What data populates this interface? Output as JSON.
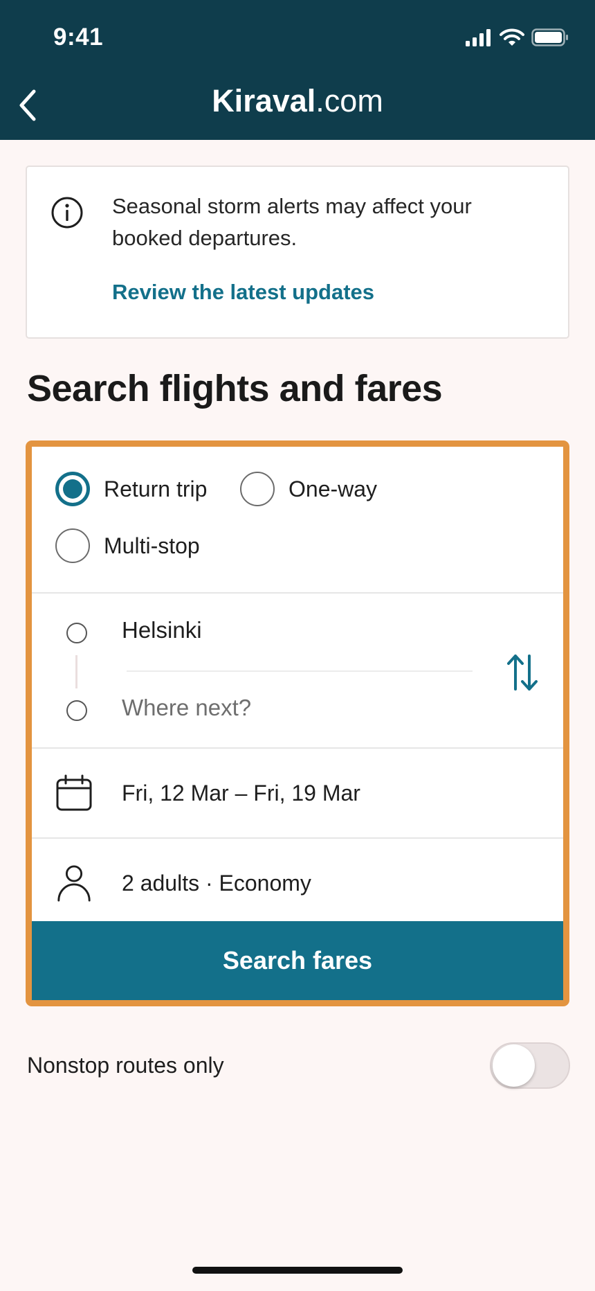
{
  "status_bar": {
    "time": "9:41"
  },
  "header": {
    "brand_bold": "Kiraval",
    "brand_rest": ".com"
  },
  "alert": {
    "message": "Seasonal storm alerts may affect your booked departures.",
    "link": "Review the latest updates"
  },
  "page_title": "Search flights and fares",
  "search_form": {
    "trip_types": [
      {
        "label": "Return trip",
        "selected": true
      },
      {
        "label": "One-way",
        "selected": false
      },
      {
        "label": "Multi-stop",
        "selected": false
      }
    ],
    "origin": "Helsinki",
    "destination_placeholder": "Where next?",
    "dates": "Fri, 12 Mar – Fri, 19 Mar",
    "passengers": "2 adults · Economy",
    "submit_label": "Search fares"
  },
  "nonstop": {
    "label": "Nonstop routes only",
    "enabled": false
  },
  "colors": {
    "header_bg": "#0f3d4c",
    "accent": "#13708a",
    "card_border": "#e39440",
    "page_bg": "#fdf6f5"
  },
  "icons": {
    "back": "chevron-left-icon",
    "info": "info-circle-icon",
    "swap": "swap-vertical-icon",
    "calendar": "calendar-icon",
    "person": "person-icon",
    "signal": "cellular-signal-icon",
    "wifi": "wifi-icon",
    "battery": "battery-icon"
  }
}
